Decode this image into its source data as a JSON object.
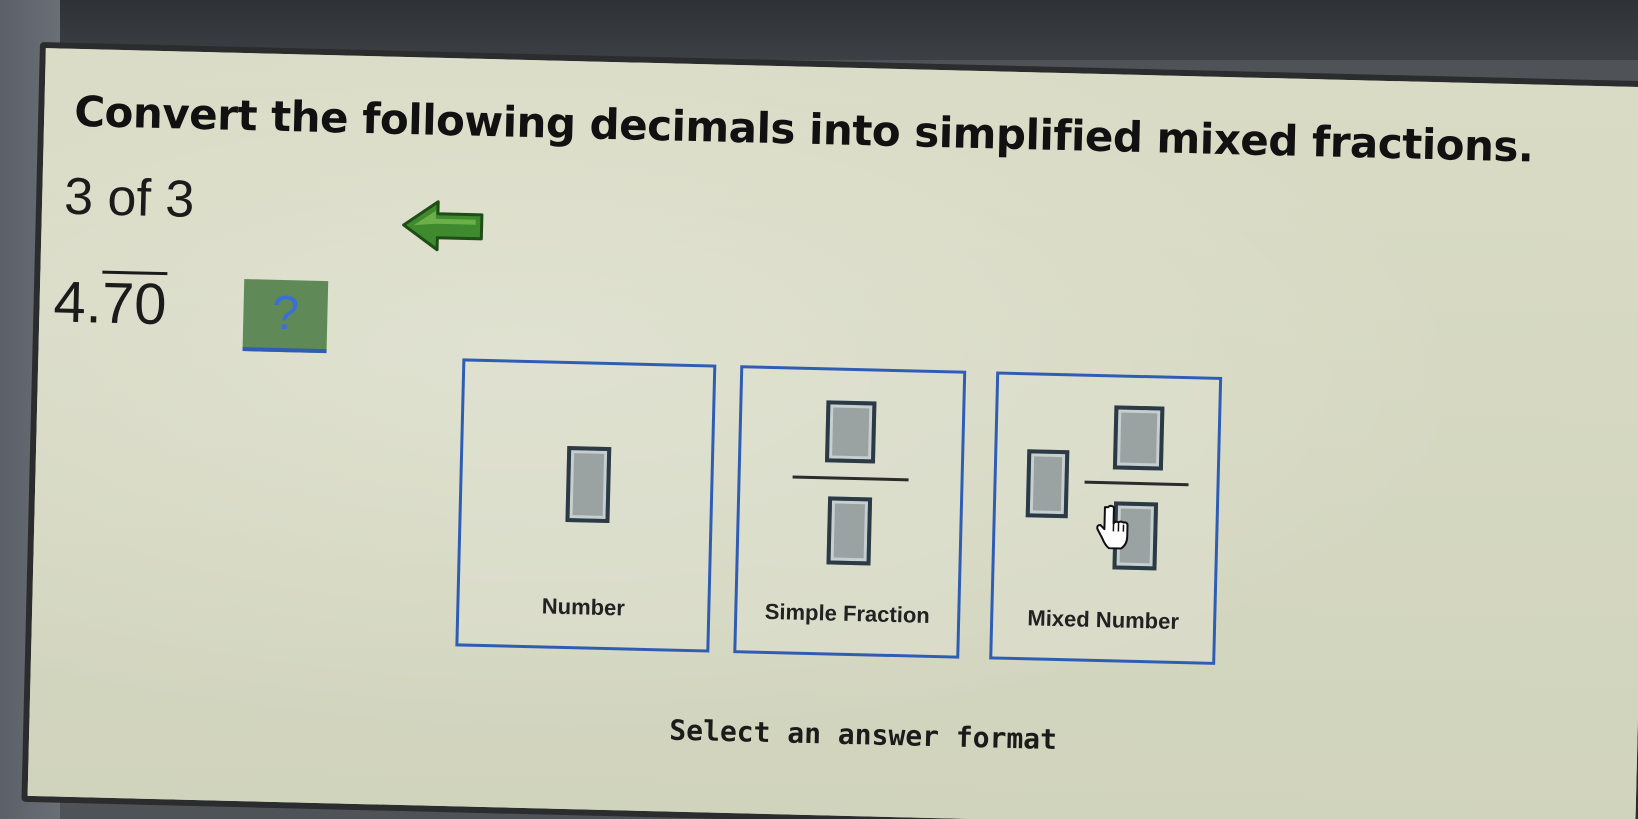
{
  "instruction": "Convert the following decimals into simplified mixed fractions.",
  "progress": "3 of 3",
  "problem": {
    "whole_part": "4.",
    "repeating_part": "70"
  },
  "answer_slot": "?",
  "formats": [
    {
      "label": "Number"
    },
    {
      "label": "Simple Fraction"
    },
    {
      "label": "Mixed Number"
    }
  ],
  "status": "Select an answer format",
  "colors": {
    "panel_background": "#d7d9c4",
    "format_border": "#2f5db3",
    "back_arrow": "#3f8a2e",
    "answer_slot_fill": "#5f8a58"
  },
  "icons": {
    "back": "left-arrow-icon",
    "cursor": "pointer-hand-icon"
  }
}
